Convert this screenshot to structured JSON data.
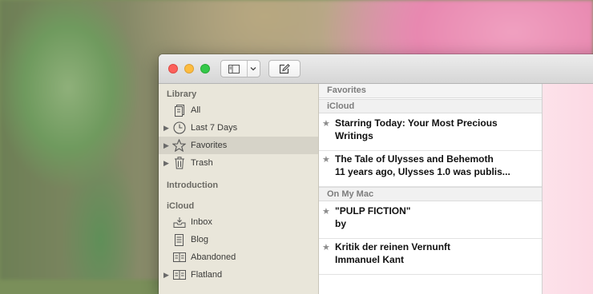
{
  "toolbar": {
    "sidebar_toggle_icon": "sidebar-icon",
    "dropdown_icon": "chevron-down-icon",
    "compose_icon": "compose-icon"
  },
  "sidebar": {
    "library_heading": "Library",
    "library_items": [
      {
        "label": "All",
        "icon": "sheets-icon",
        "expandable": false
      },
      {
        "label": "Last 7 Days",
        "icon": "clock-icon",
        "expandable": true
      },
      {
        "label": "Favorites",
        "icon": "star-icon",
        "expandable": true,
        "selected": true
      },
      {
        "label": "Trash",
        "icon": "trash-icon",
        "expandable": true
      }
    ],
    "introduction_heading": "Introduction",
    "icloud_heading": "iCloud",
    "icloud_items": [
      {
        "label": "Inbox",
        "icon": "inbox-icon",
        "expandable": false
      },
      {
        "label": "Blog",
        "icon": "document-icon",
        "expandable": false
      },
      {
        "label": "Abandoned",
        "icon": "book-icon",
        "expandable": false
      },
      {
        "label": "Flatland",
        "icon": "book-icon",
        "expandable": true
      }
    ]
  },
  "list": {
    "title": "Favorites",
    "icloud_section": "iCloud",
    "icloud_entries": [
      {
        "line1": "Starring Today: Your Most Precious",
        "line2": "Writings"
      },
      {
        "line1": "The Tale of Ulysses and Behemoth",
        "line2": "11 years ago, Ulysses 1.0 was publis..."
      }
    ],
    "mac_section": "On My Mac",
    "mac_entries": [
      {
        "line1": "\"PULP FICTION\"",
        "line2": "by"
      },
      {
        "line1": "Kritik der reinen Vernunft",
        "line2": "Immanuel Kant"
      }
    ],
    "star": "★"
  },
  "colors": {
    "sidebar_bg": "#e9e6da",
    "selection": "#d6d3c8",
    "editor_bg": "#fde2ea"
  }
}
